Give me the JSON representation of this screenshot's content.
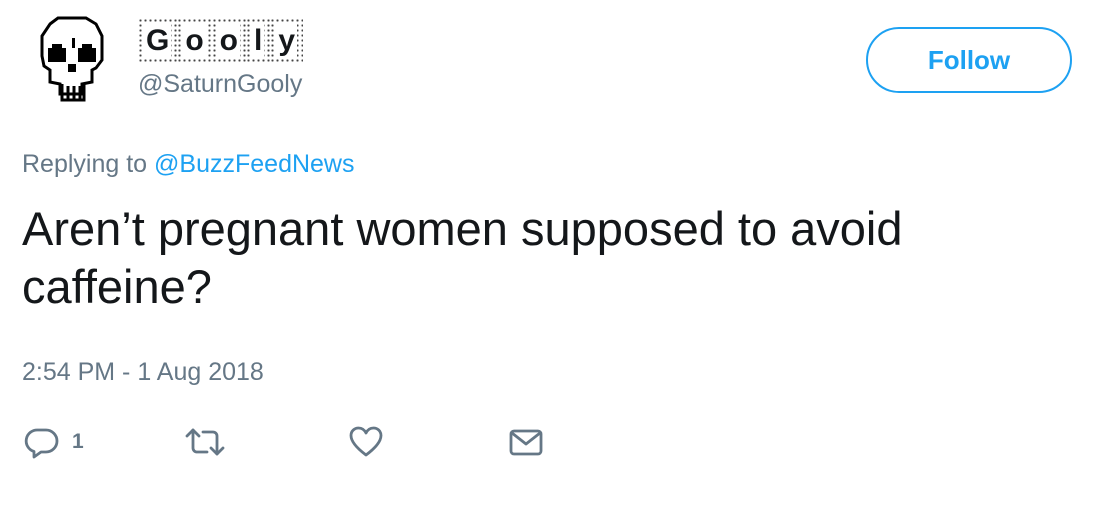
{
  "user": {
    "display_name_chars": [
      "G",
      "o",
      "o",
      "l",
      "y"
    ],
    "handle": "@SaturnGooly"
  },
  "follow_button": {
    "label": "Follow"
  },
  "reply_context": {
    "prefix": "Replying to",
    "target": "@BuzzFeedNews"
  },
  "tweet": {
    "text": "Aren’t pregnant women supposed to avoid caffeine?",
    "timestamp": "2:54 PM - 1 Aug 2018"
  },
  "actions": {
    "reply_count": "1"
  },
  "colors": {
    "accent": "#1da1f2",
    "secondary_text": "#657786",
    "primary_text": "#14171a"
  },
  "icons": [
    "skull-avatar",
    "reply-icon",
    "retweet-icon",
    "like-icon",
    "direct-message-icon"
  ]
}
